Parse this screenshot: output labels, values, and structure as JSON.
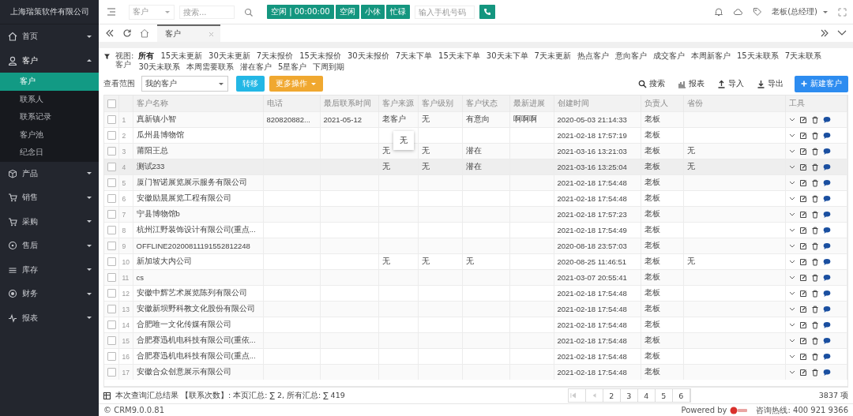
{
  "sidebar": {
    "company": "上海瑞策软件有限公司",
    "items": [
      {
        "label": "首页",
        "expanded": false
      },
      {
        "label": "客户",
        "expanded": true,
        "children": [
          {
            "label": "客户",
            "selected": true
          },
          {
            "label": "联系人",
            "selected": false
          },
          {
            "label": "联系记录",
            "selected": false
          },
          {
            "label": "客户池",
            "selected": false
          },
          {
            "label": "纪念日",
            "selected": false
          }
        ]
      },
      {
        "label": "产品",
        "expanded": false
      },
      {
        "label": "销售",
        "expanded": false
      },
      {
        "label": "采购",
        "expanded": false
      },
      {
        "label": "售后",
        "expanded": false
      },
      {
        "label": "库存",
        "expanded": false
      },
      {
        "label": "财务",
        "expanded": false
      },
      {
        "label": "报表",
        "expanded": false
      }
    ]
  },
  "topbar": {
    "module_select": "客户",
    "search": {
      "placeholder": "搜索..."
    },
    "status_buttons": [
      "空闲 | 00:00:00",
      "空闲",
      "小休",
      "忙碌"
    ],
    "phone": {
      "placeholder": "输入手机号码"
    },
    "user": "老板(总经理)"
  },
  "tabs": [
    {
      "label": "客户",
      "selected": true
    }
  ],
  "views": {
    "label": "视图:",
    "current": "客户",
    "items": [
      {
        "label": "所有",
        "selected": true
      },
      {
        "label": "15天未更新",
        "selected": false
      },
      {
        "label": "30天未更新",
        "selected": false
      },
      {
        "label": "7天未报价",
        "selected": false
      },
      {
        "label": "15天未报价",
        "selected": false
      },
      {
        "label": "30天未报价",
        "selected": false
      },
      {
        "label": "7天未下单",
        "selected": false
      },
      {
        "label": "15天未下单",
        "selected": false
      },
      {
        "label": "30天未下单",
        "selected": false
      },
      {
        "label": "7天未更新",
        "selected": false
      },
      {
        "label": "热点客户",
        "selected": false
      },
      {
        "label": "意向客户",
        "selected": false
      },
      {
        "label": "成交客户",
        "selected": false
      },
      {
        "label": "本周新客户",
        "selected": false
      },
      {
        "label": "15天未联系",
        "selected": false
      },
      {
        "label": "7天未联系",
        "selected": false
      },
      {
        "label": "30天未联系",
        "selected": false
      },
      {
        "label": "本周需要联系",
        "selected": false
      },
      {
        "label": "潜在客户",
        "selected": false
      },
      {
        "label": "5星客户",
        "selected": false
      },
      {
        "label": "下周到期",
        "selected": false
      }
    ]
  },
  "query": {
    "label": "查看范围",
    "scope": "我的客户",
    "transfer": "转移",
    "more": "更多操作",
    "actions": [
      {
        "kind": "search",
        "label": "搜索"
      },
      {
        "kind": "report",
        "label": "报表"
      },
      {
        "kind": "import",
        "label": "导入"
      },
      {
        "kind": "export",
        "label": "导出"
      }
    ],
    "new_button": "新建客户"
  },
  "table": {
    "select_all_checked": false,
    "columns": [
      "客户名称",
      "电话",
      "最后联系时间",
      "客户来源",
      "客户级别",
      "客户状态",
      "最新进展",
      "创建时间",
      "负责人",
      "省份",
      "工具"
    ],
    "rows": [
      {
        "no": "1",
        "hovered": false,
        "cells": [
          "真新镇小智",
          "820820882...",
          "2021-05-12",
          "老客户",
          "无",
          "有意向",
          "啊啊啊",
          "2020-05-03 21:14:33",
          "老板",
          ""
        ]
      },
      {
        "no": "2",
        "hovered": false,
        "cells": [
          "瓜州县博物馆",
          "",
          "",
          "",
          "",
          "",
          "",
          "2021-02-18 17:57:19",
          "老板",
          ""
        ]
      },
      {
        "no": "3",
        "hovered": false,
        "cells": [
          "莆阳王总",
          "",
          "",
          {
            "text": "无",
            "tooltip": "无"
          },
          "无",
          "潜在",
          "",
          "2021-03-16 13:21:03",
          "老板",
          "无"
        ]
      },
      {
        "no": "4",
        "hovered": true,
        "cells": [
          "测试233",
          "",
          "",
          "无",
          "无",
          "潜在",
          "",
          "2021-03-16 13:25:04",
          "老板",
          "无"
        ]
      },
      {
        "no": "5",
        "hovered": false,
        "cells": [
          "厦门智诺展览展示服务有限公司",
          "",
          "",
          "",
          "",
          "",
          "",
          "2021-02-18 17:54:48",
          "老板",
          ""
        ]
      },
      {
        "no": "6",
        "hovered": false,
        "cells": [
          "安徽励晨展览工程有限公司",
          "",
          "",
          "",
          "",
          "",
          "",
          "2021-02-18 17:54:48",
          "老板",
          ""
        ]
      },
      {
        "no": "7",
        "hovered": false,
        "cells": [
          "宁县博物馆b",
          "",
          "",
          "",
          "",
          "",
          "",
          "2021-02-18 17:57:23",
          "老板",
          ""
        ]
      },
      {
        "no": "8",
        "hovered": false,
        "cells": [
          "杭州江野装饰设计有限公司(重点...",
          "",
          "",
          "",
          "",
          "",
          "",
          "2021-02-18 17:54:49",
          "老板",
          ""
        ]
      },
      {
        "no": "9",
        "hovered": false,
        "cells": [
          "OFFLINE20200811191552812248",
          "",
          "",
          "",
          "",
          "",
          "",
          "2020-08-18 23:57:03",
          "老板",
          ""
        ]
      },
      {
        "no": "10",
        "hovered": false,
        "cells": [
          "新加坡大内公司",
          "",
          "",
          "无",
          "无",
          "无",
          "",
          "2020-08-25 11:46:51",
          "老板",
          "无"
        ]
      },
      {
        "no": "11",
        "hovered": false,
        "cells": [
          "cs",
          "",
          "",
          "",
          "",
          "",
          "",
          "2021-03-07 20:55:41",
          "老板",
          ""
        ]
      },
      {
        "no": "12",
        "hovered": false,
        "cells": [
          "安徽中辉艺术展览陈列有限公司",
          "",
          "",
          "",
          "",
          "",
          "",
          "2021-02-18 17:54:48",
          "老板",
          ""
        ]
      },
      {
        "no": "13",
        "hovered": false,
        "cells": [
          "安徽新坝野科教文化股份有限公司",
          "",
          "",
          "",
          "",
          "",
          "",
          "2021-02-18 17:54:48",
          "老板",
          ""
        ]
      },
      {
        "no": "14",
        "hovered": false,
        "cells": [
          "合肥唯一文化传媒有限公司",
          "",
          "",
          "",
          "",
          "",
          "",
          "2021-02-18 17:54:48",
          "老板",
          ""
        ]
      },
      {
        "no": "15",
        "hovered": false,
        "cells": [
          "合肥赛迅机电科技有限公司(重依...",
          "",
          "",
          "",
          "",
          "",
          "",
          "2021-02-18 17:54:48",
          "老板",
          ""
        ]
      },
      {
        "no": "16",
        "hovered": false,
        "cells": [
          "合肥赛迅机电科技有限公司(重点...",
          "",
          "",
          "",
          "",
          "",
          "",
          "2021-02-18 17:54:48",
          "老板",
          ""
        ]
      },
      {
        "no": "17",
        "hovered": false,
        "cells": [
          "安徽合众创意展示有限公司",
          "",
          "",
          "",
          "",
          "",
          "",
          "2021-02-18 17:54:48",
          "老板",
          ""
        ]
      }
    ]
  },
  "summary": "本次查询汇总结果 【联系次数】: 本页汇总: ∑ 2, 所有汇总: ∑ 419",
  "pagination": {
    "pages": [
      "2",
      "3",
      "4",
      "5",
      "6"
    ],
    "total": "3837 项"
  },
  "status_bar": {
    "version": "© CRM9.0.0.81",
    "powered": "Powered by",
    "hotline": "咨询热线: 400 921 9366"
  }
}
